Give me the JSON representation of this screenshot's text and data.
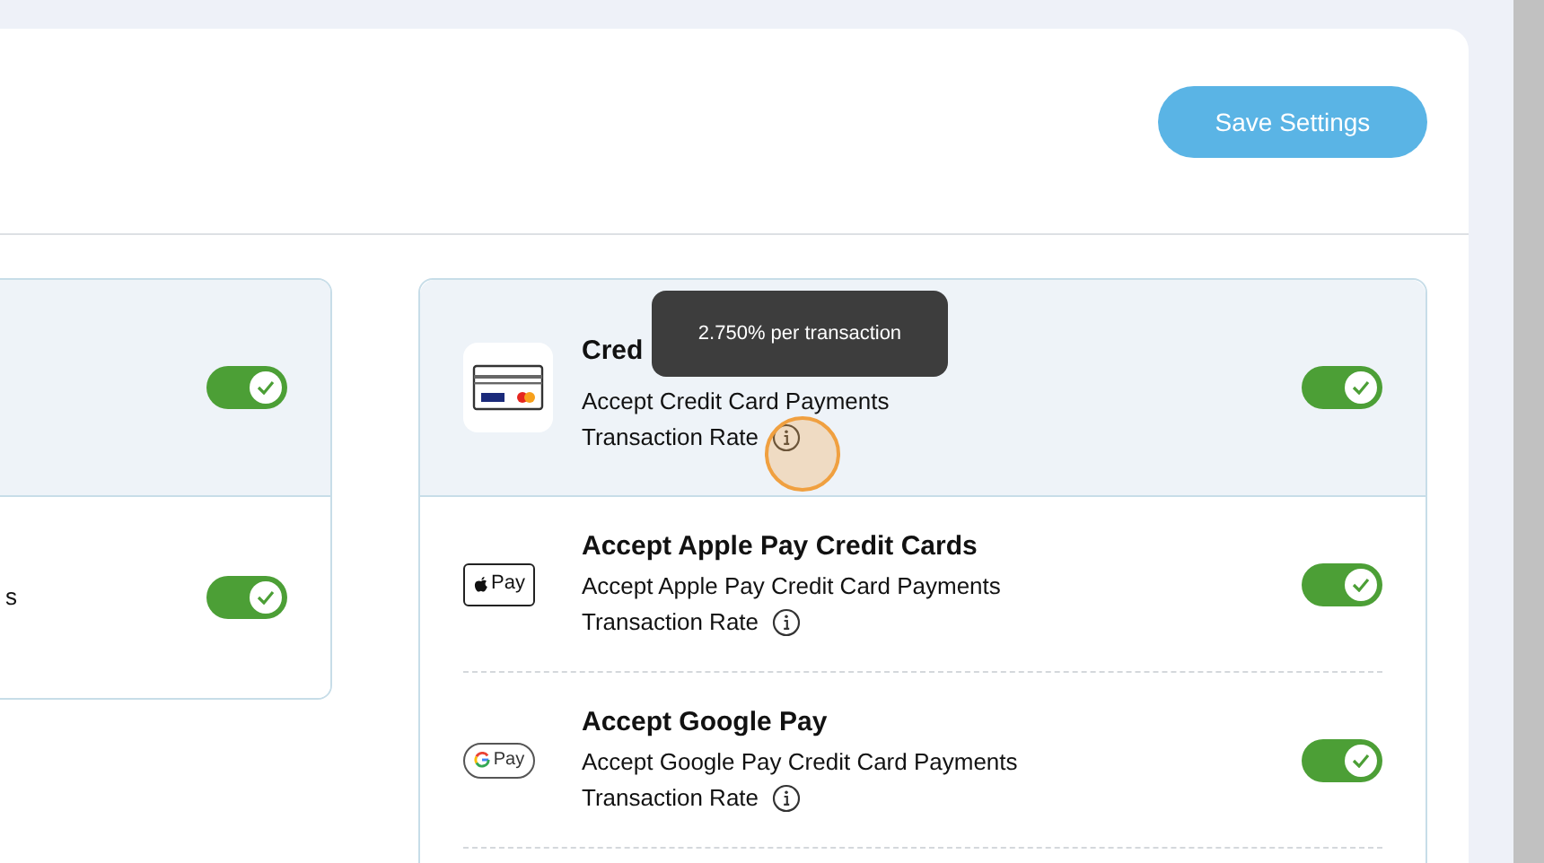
{
  "header": {
    "save_button": "Save Settings"
  },
  "left_panel": {
    "rows": [
      {
        "highlighted": true,
        "on": true
      },
      {
        "highlighted": false,
        "text": "s",
        "on": true
      }
    ]
  },
  "right_panel": {
    "rows": [
      {
        "kind": "card",
        "highlighted": true,
        "title": "Cred",
        "description": "Accept Credit Card Payments",
        "rate_label": "Transaction Rate",
        "on": true
      },
      {
        "kind": "apple",
        "logo_text": "Pay",
        "highlighted": false,
        "title": "Accept Apple Pay Credit Cards",
        "description": "Accept Apple Pay Credit Card Payments",
        "rate_label": "Transaction Rate",
        "on": true
      },
      {
        "kind": "google",
        "logo_text": "Pay",
        "highlighted": false,
        "title": "Accept  Google Pay",
        "description": "Accept Google Pay Credit Card Payments",
        "rate_label": "Transaction Rate",
        "on": true
      }
    ]
  },
  "tooltip": {
    "text": "2.750% per transaction"
  }
}
